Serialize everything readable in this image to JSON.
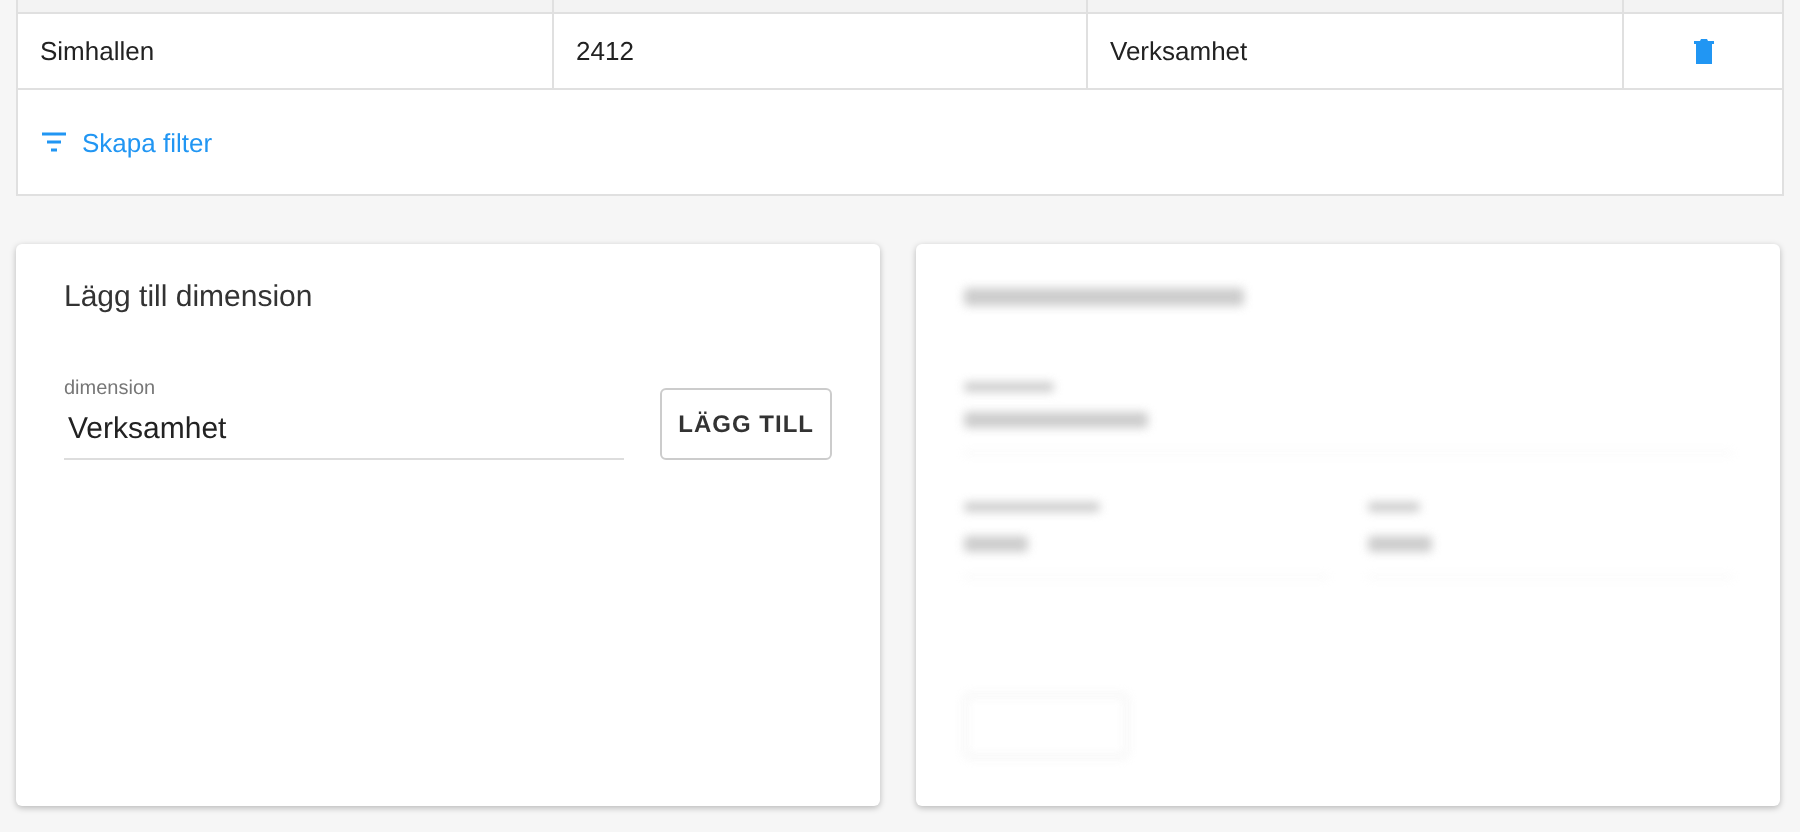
{
  "table": {
    "rows": [
      {
        "cells": [
          "Simhallen",
          "2412",
          "Verksamhet"
        ]
      }
    ],
    "create_filter": "Skapa filter"
  },
  "dimension_card": {
    "title": "Lägg till dimension",
    "field": {
      "label": "dimension",
      "value": "Verksamhet"
    },
    "button": "LÄGG TILL"
  },
  "account_card": {
    "blurred": true
  }
}
